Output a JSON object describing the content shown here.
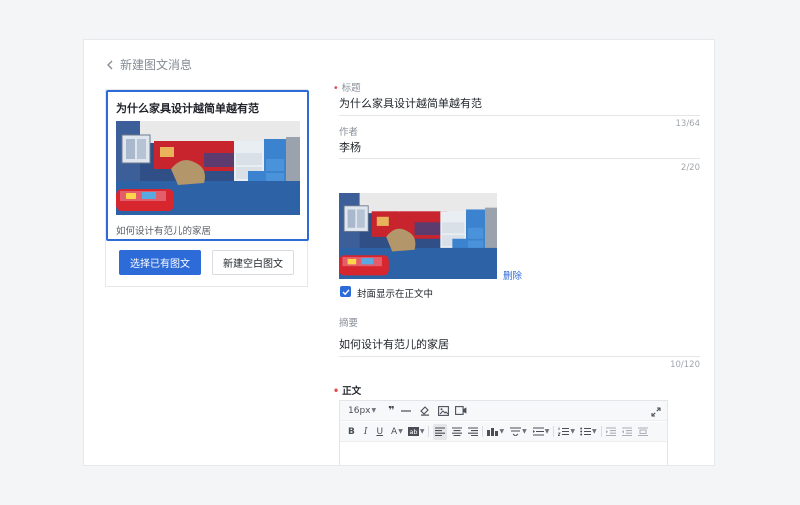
{
  "page": {
    "back_label": "新建图文消息"
  },
  "preview_card": {
    "title": "为什么家具设计越简单越有范",
    "digest": "如何设计有范儿的家居",
    "image_desc": "kids-bedroom-photo"
  },
  "actions": {
    "select_existing": "选择已有图文",
    "create_blank": "新建空白图文"
  },
  "form": {
    "title_label": "标题",
    "title_value": "为什么家具设计越简单越有范",
    "title_count": "13/64",
    "author_label": "作者",
    "author_value": "李杨",
    "author_count": "2/20",
    "delete_label": "删除",
    "cover_in_body_label": "封面显示在正文中",
    "cover_in_body_checked": true,
    "digest_label": "摘要",
    "digest_value": "如何设计有范儿的家居",
    "digest_count": "10/120",
    "body_label": "正文"
  },
  "editor": {
    "font_size": "16px",
    "toolbar_row1": [
      "font-size-dropdown",
      "quote-icon",
      "divider-icon",
      "clear-format-icon",
      "image-icon",
      "video-icon",
      "fullscreen-icon"
    ],
    "toolbar_row2": [
      "bold-icon",
      "italic-icon",
      "underline-icon",
      "font-color-icon",
      "background-color-icon",
      "align-left-icon",
      "align-center-icon",
      "align-right-icon",
      "text-indent-icon",
      "paragraph-spacing-icon",
      "line-height-icon",
      "ordered-list-icon",
      "unordered-list-icon",
      "indent-icon",
      "outdent-icon",
      "more-icon"
    ]
  },
  "colors": {
    "accent": "#2d6bd8",
    "required": "#e5484d"
  }
}
